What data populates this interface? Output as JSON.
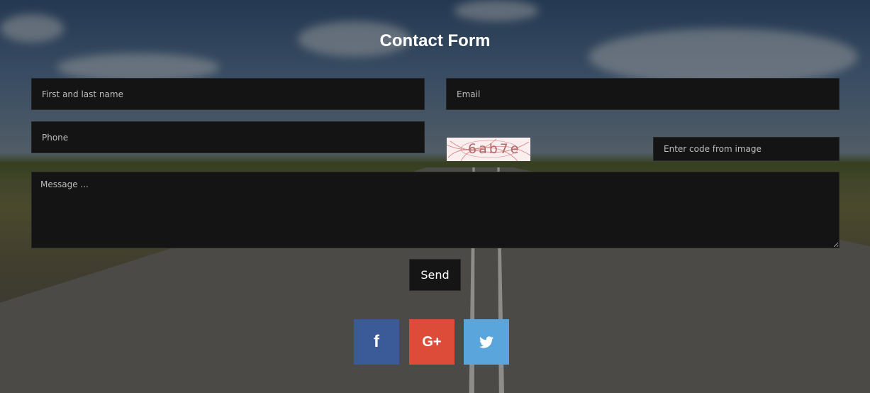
{
  "form": {
    "title": "Contact Form",
    "name_placeholder": "First and last name",
    "email_placeholder": "Email",
    "phone_placeholder": "Phone",
    "captcha_text": "6ab7e",
    "captcha_placeholder": "Enter code from image",
    "message_placeholder": "Message ...",
    "send_label": "Send"
  },
  "social": [
    {
      "name": "facebook",
      "glyph": "f",
      "color": "#3b5a98"
    },
    {
      "name": "google-plus",
      "glyph": "G+",
      "color": "#dd4b39"
    },
    {
      "name": "twitter",
      "glyph": "twitter-bird",
      "color": "#5aa6dc"
    }
  ]
}
